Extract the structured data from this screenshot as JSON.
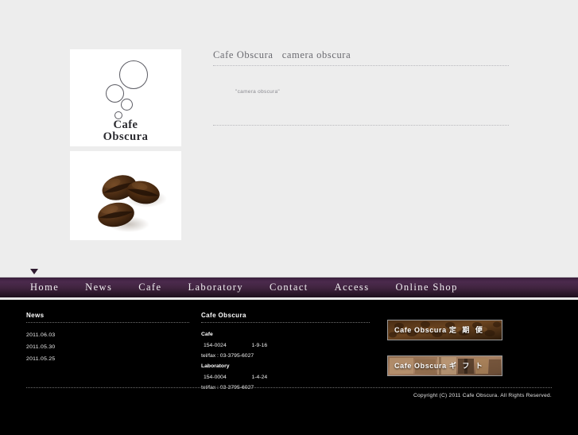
{
  "site": {
    "logo_line1": "Cafe",
    "logo_line2": "Obscura"
  },
  "main": {
    "headline": "Cafe Obscura   camera obscura",
    "subtext": "\"camera obscura\""
  },
  "nav": {
    "items": [
      {
        "label": "Home"
      },
      {
        "label": "News"
      },
      {
        "label": "Cafe"
      },
      {
        "label": "Laboratory"
      },
      {
        "label": "Contact"
      },
      {
        "label": "Access"
      },
      {
        "label": "Online Shop"
      }
    ]
  },
  "footer": {
    "news": {
      "heading": "News",
      "items": [
        {
          "date": "2011.06.03"
        },
        {
          "date": "2011.05.30"
        },
        {
          "date": "2011.05.25"
        }
      ]
    },
    "info": {
      "heading": "Cafe Obscura",
      "cafe": {
        "label": "Cafe",
        "postal": "154-0024",
        "address": "1-9-16",
        "telfax": "tel/fax : 03-3795-6027"
      },
      "laboratory": {
        "label": "Laboratory",
        "postal": "154-0004",
        "address": "1-4-24",
        "telfax": "tel/fax : 03-3795-6027"
      }
    },
    "banners": [
      {
        "brand": "Cafe Obscura",
        "jp": "定 期 便"
      },
      {
        "brand": "Cafe Obscura",
        "jp": "ギ フ ト"
      }
    ],
    "copyright": "Copyright (C) 2011 Cafe Obscura. All Rights Reserved."
  },
  "colors": {
    "page_bg": "#ededed",
    "nav_bg": "#40243f",
    "footer_bg": "#000000",
    "accent_text": "#6a6a70"
  }
}
